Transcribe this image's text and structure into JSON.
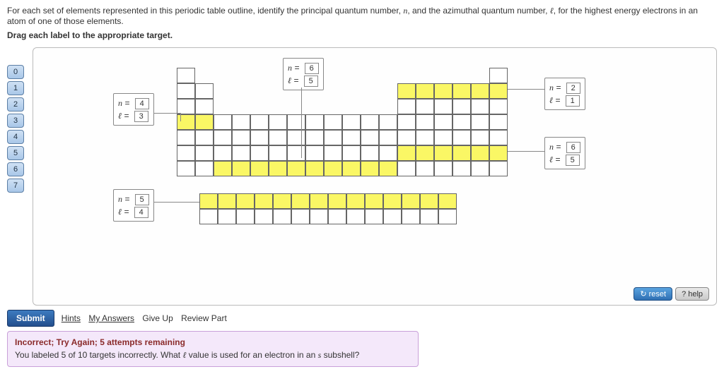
{
  "instructions": {
    "line1_a": "For each set of elements represented in this periodic table outline, identify the principal quantum number, ",
    "nsym": "n",
    "line1_b": ", and the azimuthal quantum number, ",
    "lsym": "ℓ",
    "line1_c": ", for the highest energy electrons in an atom of one of those elements.",
    "line2": "Drag each label to the appropriate target."
  },
  "palette": [
    "0",
    "1",
    "2",
    "3",
    "4",
    "5",
    "6",
    "7"
  ],
  "labels": {
    "box1": {
      "n": "4",
      "l": "3"
    },
    "box2": {
      "n": "6",
      "l": "5"
    },
    "box3": {
      "n": "2",
      "l": "1"
    },
    "box4": {
      "n": "6",
      "l": "5"
    },
    "box5": {
      "n": "5",
      "l": "4"
    }
  },
  "buttons": {
    "reset": "reset",
    "help": "help",
    "submit": "Submit",
    "hints": "Hints",
    "myanswers": "My Answers",
    "giveup": "Give Up",
    "review": "Review Part"
  },
  "feedback": {
    "heading": "Incorrect; Try Again; 5 attempts remaining",
    "body_a": "You labeled 5 of 10 targets incorrectly. What ",
    "body_l": "ℓ",
    "body_b": " value is used for an electron in an ",
    "body_s": "s",
    "body_c": " subshell?"
  }
}
